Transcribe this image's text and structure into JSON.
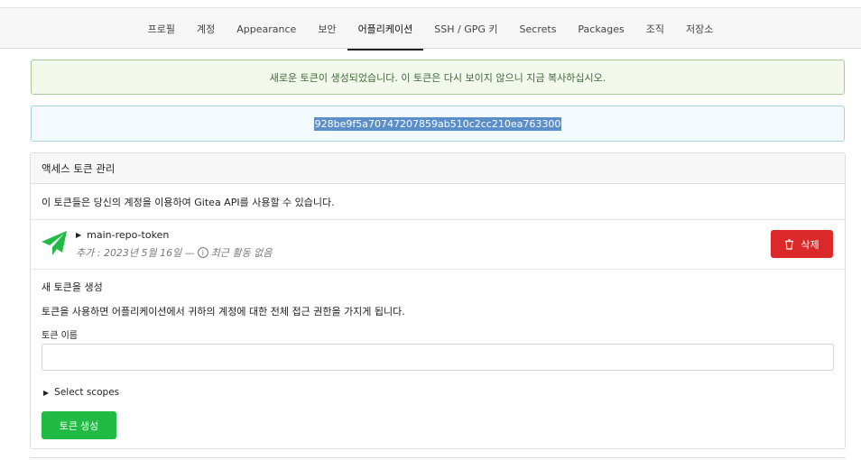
{
  "nav": {
    "tabs": [
      {
        "label": "프로필"
      },
      {
        "label": "계정"
      },
      {
        "label": "Appearance"
      },
      {
        "label": "보안"
      },
      {
        "label": "어플리케이션",
        "active": true
      },
      {
        "label": "SSH / GPG 키"
      },
      {
        "label": "Secrets"
      },
      {
        "label": "Packages"
      },
      {
        "label": "조직"
      },
      {
        "label": "저장소"
      }
    ]
  },
  "alerts": {
    "success": "새로운 토큰이 생성되었습니다. 이 토큰은 다시 보이지 않으니 지금 복사하십시오.",
    "token": "928be9f5a70747207859ab510c2cc210ea763300"
  },
  "panel": {
    "header": "액세스 토큰 관리",
    "description": "이 토큰들은 당신의 계정을 이용하여 Gitea API를 사용할 수 있습니다.",
    "token": {
      "name": "main-repo-token",
      "added": "추가 : 2023년 5월 16일 —",
      "activity": "최근 활동 없음",
      "delete_label": "삭제"
    },
    "create": {
      "title": "새 토큰을 생성",
      "description": "토큰을 사용하면 어플리케이션에서 귀하의 계정에 대한 전체 접근 권한을 가지게 됩니다.",
      "name_label": "토큰 이름",
      "name_value": "",
      "scopes_label": "Select scopes",
      "submit_label": "토큰 생성"
    }
  },
  "colors": {
    "delete": "#db2828",
    "create": "#21ba45",
    "send_icon": "#21ba45"
  },
  "icons": {
    "token": "send-icon",
    "delete": "trash-icon",
    "info": "info-icon"
  }
}
